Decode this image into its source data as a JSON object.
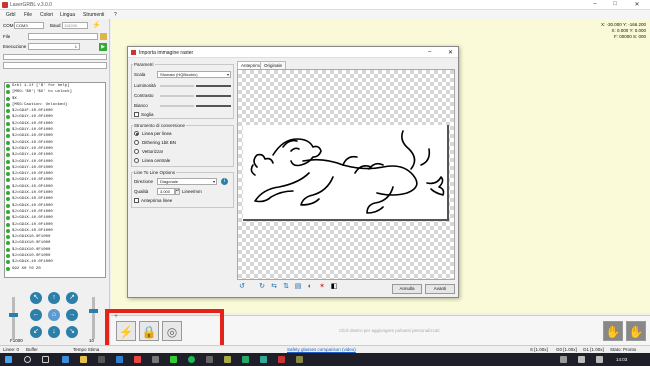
{
  "window": {
    "title": "LaserGRBL v.3.0.0"
  },
  "menu": [
    "Grbl",
    "File",
    "Colori",
    "Lingua",
    "Strumenti",
    "?"
  ],
  "connection": {
    "com_label": "COM",
    "com_value": "COM3",
    "baud_label": "Baud",
    "baud_value": "115200",
    "file_label": "File",
    "exec_label": "Esecuzione",
    "exec_value": "1"
  },
  "console_lines": [
    "Grbl 1.1f ['$' for help]",
    "[MSG:'$H'|'$X' to unlock]",
    "$X",
    "[MSG:Caution: Unlocked]",
    "$J=G91F-10.0F1000",
    "$J=G91Y-10.0F1000",
    "$J=G91X-10.0F1000",
    "$J=G91Y-10.0F1000",
    "$J=G91X-10.0F1000",
    "$J=G91X-10.0F1000",
    "$J=G91Y-10.0F1000",
    "$J=G91Y-10.0F1000",
    "$J=G91Y-10.0F1000",
    "$J=G91Y-10.0F1000",
    "$J=G91Y-10.0F1000",
    "$J=G91Y-10.0F1000",
    "$J=G91X-10.0F1000",
    "$J=G91X-10.0F1000",
    "$J=G91X-10.0F1000",
    "$J=G91X-10.0F1000",
    "$J=G91Y-10.0F1000",
    "$J=G91X-10.0F1000",
    "$J=G91X-10.0F1000",
    "$J=G91X-10.0F1000",
    "$J=G91X10.0F1000",
    "$J=G91X10.0F1000",
    "$J=G91X10.0F1000",
    "$J=G91X10.0F1000",
    "$J=G91X-10.0F1000",
    "G92 X0 Y0 Z0"
  ],
  "jog": {
    "speed": "F1000",
    "step": "10"
  },
  "coords": {
    "x": "X: -30.000 Y: -166.200",
    "s": "X: 0.000 Y: 0.000",
    "f": "F: 00000 S: 000"
  },
  "dialog": {
    "title": "Importa immagine raster",
    "params_title": "Parametri",
    "scala_label": "Scala",
    "scala_value": "Sfumato (HQBicubic)",
    "luminosita": "Luminosità",
    "contrasto": "Contrasto",
    "bianco": "Bianco",
    "soglia": "Soglia",
    "strumento_title": "Strumento di conversione",
    "radios": [
      "Linea per linea",
      "Dithering 1bit BN",
      "Vettorizza!",
      "Linea centrale"
    ],
    "line_options_title": "Line To Line Options",
    "direzione_label": "Direzione",
    "direzione_value": "Diagonale",
    "qualita_label": "Qualità",
    "qualita_value": "3.000",
    "qualita_unit": "Linee/mm",
    "anteprima_linee": "Anteprima linee",
    "tab_preview": "Anteprima",
    "tab_original": "Originale",
    "cancel": "Annulla",
    "next": "Avanti"
  },
  "bottom": {
    "hint": "Click destro per aggiungere pulsanti personalizzati"
  },
  "status": {
    "linee": "Linee: 0",
    "buffer": "Buffer",
    "tempo": "Tempo Stima",
    "link": "Safety glasses comparison (video)",
    "s1": "S [1.00x]",
    "g0": "G0 [1.00x]",
    "g1": "G1 [1.00x]",
    "stato": "Stato: Pronto"
  },
  "clock": "14:03",
  "colors": {
    "accent": "#2c7fa8",
    "redbox": "#e3231c",
    "main_bg": "#fafad8"
  }
}
